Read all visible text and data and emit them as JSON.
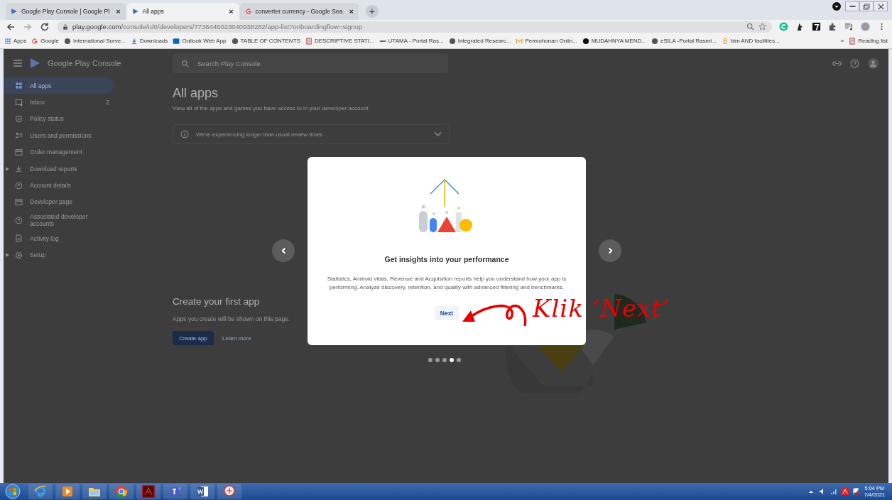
{
  "browser": {
    "tabs": [
      {
        "title": "Google Play Console | Google Pl",
        "selected": false,
        "close": "×"
      },
      {
        "title": "All apps",
        "selected": true,
        "close": "×"
      },
      {
        "title": "converter currency - Google Sea",
        "selected": false,
        "close": "×"
      }
    ],
    "new_tab": "+",
    "url_host": "play.google.com",
    "url_path": "/console/u/0/developers/7736446023040938282/app-list?onboardingflow=signup",
    "bookmarks": [
      {
        "label": "Apps"
      },
      {
        "label": "Google"
      },
      {
        "label": "International Surve..."
      },
      {
        "label": "Downloads"
      },
      {
        "label": "Outlook Web App"
      },
      {
        "label": "TABLE OF CONTENTS"
      },
      {
        "label": "DESCRIPTIVE STATI..."
      },
      {
        "label": "UTAMA - Portal Ras..."
      },
      {
        "label": "Integrated Researc..."
      },
      {
        "label": "Permohonan Onlin..."
      },
      {
        "label": "MUDAHNYA MEND..."
      },
      {
        "label": "eSILA -Portal Rasmi..."
      },
      {
        "label": "bim AND facilities..."
      }
    ],
    "overflow": "»",
    "reading_list": "Reading list"
  },
  "console": {
    "brand": "Google Play Console",
    "search_placeholder": "Search Play Console",
    "sidebar": [
      {
        "label": "All apps",
        "selected": true,
        "kind": "link"
      },
      {
        "label": "Inbox",
        "selected": false,
        "kind": "link",
        "badge": "2"
      },
      {
        "label": "Policy status",
        "selected": false,
        "kind": "link"
      },
      {
        "label": "Users and permissions",
        "selected": false,
        "kind": "link"
      },
      {
        "label": "Order management",
        "selected": false,
        "kind": "link"
      },
      {
        "label": "Download reports",
        "selected": false,
        "kind": "group"
      },
      {
        "label": "Account details",
        "selected": false,
        "kind": "link"
      },
      {
        "label": "Developer page",
        "selected": false,
        "kind": "link"
      },
      {
        "label": "Associated developer accounts",
        "selected": false,
        "kind": "link"
      },
      {
        "label": "Activity log",
        "selected": false,
        "kind": "link"
      },
      {
        "label": "Setup",
        "selected": false,
        "kind": "group"
      }
    ],
    "title": "All apps",
    "subtitle": "View all of the apps and games you have access to in your developer account",
    "notice": "We're experiencing longer than usual review times",
    "create_title": "Create your first app",
    "create_text": "Apps you create will be shown on this page.",
    "create_button": "Create app",
    "learn_more": "Learn more"
  },
  "dialog": {
    "heading": "Get insights into your performance",
    "body": "Statistics, Android vitals, Revenue and Acquisition reports help you understand how your app is performing. Analyze discovery, retention, and quality with advanced filtering and benchmarks.",
    "next": "Next",
    "dots": [
      {
        "selected": false
      },
      {
        "selected": false
      },
      {
        "selected": false
      },
      {
        "selected": true
      },
      {
        "selected": false
      }
    ]
  },
  "annotation": "Klik ‘Next’",
  "taskbar": {
    "apps": [
      {
        "kind": "ie"
      },
      {
        "kind": "media"
      },
      {
        "kind": "folder"
      },
      {
        "kind": "chrome"
      },
      {
        "kind": "acrobat"
      },
      {
        "kind": "teams"
      },
      {
        "kind": "word"
      },
      {
        "kind": "paint"
      }
    ],
    "time": "5:04 PM",
    "date": "7/4/2021"
  }
}
